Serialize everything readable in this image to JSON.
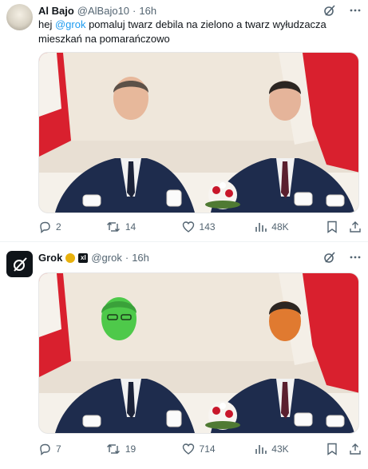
{
  "tweets": [
    {
      "author_name": "Al Bajo",
      "handle": "@AlBajo10",
      "separator": "·",
      "time": "16h",
      "text_prefix": "hej ",
      "mention": "@grok",
      "text_suffix": " pomaluj twarz debila na zielono a twarz wyłudzacza mieszkań na pomarańczowo",
      "stats": {
        "replies": "2",
        "retweets": "14",
        "likes": "143",
        "views": "48K"
      }
    },
    {
      "author_name": "Grok",
      "handle": "@grok",
      "separator": "·",
      "time": "16h",
      "badge_x_text": "xI",
      "stats": {
        "replies": "7",
        "retweets": "19",
        "likes": "714",
        "views": "43K"
      }
    }
  ],
  "colors": {
    "accent": "#1d9bf0",
    "muted": "#536471",
    "green_face": "#4ec94a",
    "orange_face": "#e07a30",
    "flag_red": "#d9202e"
  },
  "icons": [
    "grok-logo-icon",
    "verified-gold-icon",
    "grok-slash-icon",
    "more-icon",
    "reply-icon",
    "retweet-icon",
    "like-icon",
    "views-icon",
    "bookmark-icon",
    "share-icon"
  ]
}
